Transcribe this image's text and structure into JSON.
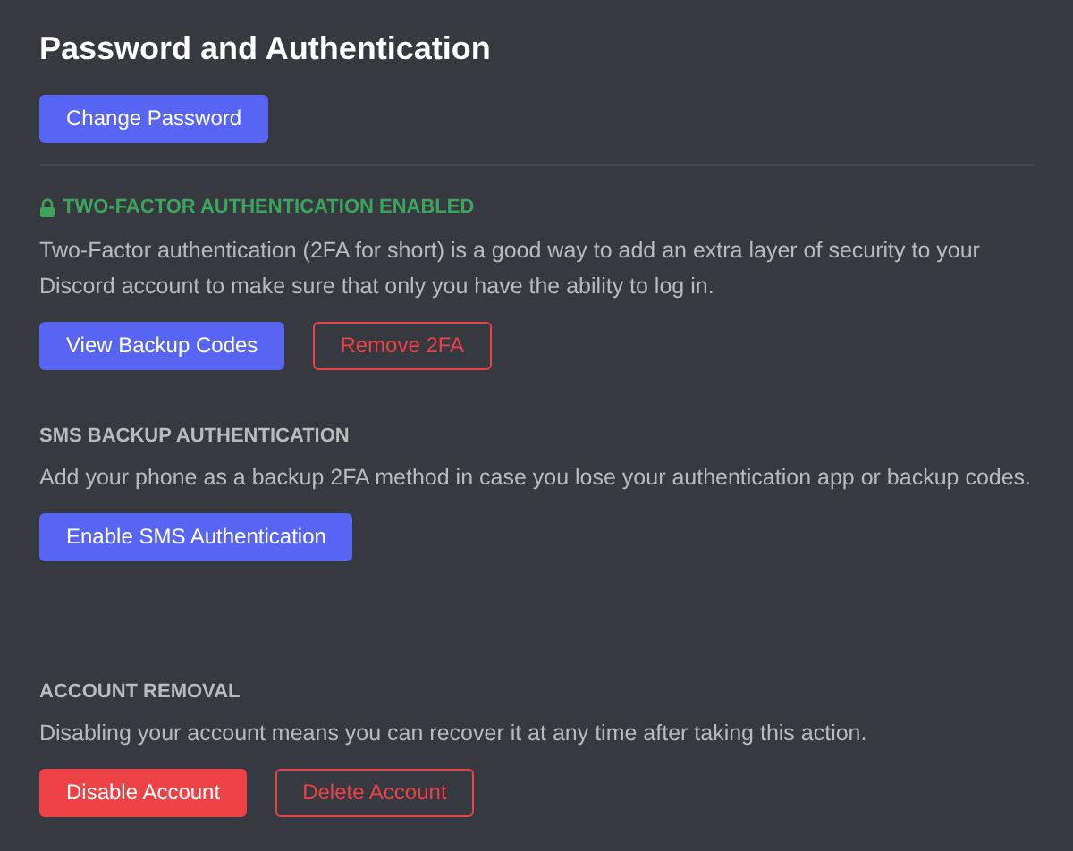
{
  "title": "Password and Authentication",
  "sections": [
    {
      "buttons": [
        {
          "label": "Change Password",
          "kind": "primary"
        }
      ]
    },
    {
      "heading": {
        "text": "TWO-FACTOR AUTHENTICATION ENABLED",
        "kind": "status"
      },
      "text": "Two-Factor authentication (2FA for short) is a good way to add an extra layer of security to your Discord account to make sure that only you have the ability to log in.",
      "buttons": [
        {
          "label": "View Backup Codes",
          "kind": "primary"
        },
        {
          "label": "Remove 2FA",
          "kind": "danger-outline"
        }
      ]
    },
    {
      "heading": {
        "text": "SMS BACKUP AUTHENTICATION",
        "kind": "label"
      },
      "text": "Add your phone as a backup 2FA method in case you lose your authentication app or backup codes.",
      "buttons": [
        {
          "label": "Enable SMS Authentication",
          "kind": "primary"
        }
      ]
    },
    {
      "heading": {
        "text": "ACCOUNT REMOVAL",
        "kind": "label"
      },
      "text": "Disabling your account means you can recover it at any time after taking this action.",
      "buttons": [
        {
          "label": "Disable Account",
          "kind": "danger"
        },
        {
          "label": "Delete Account",
          "kind": "danger-outline"
        }
      ]
    }
  ]
}
